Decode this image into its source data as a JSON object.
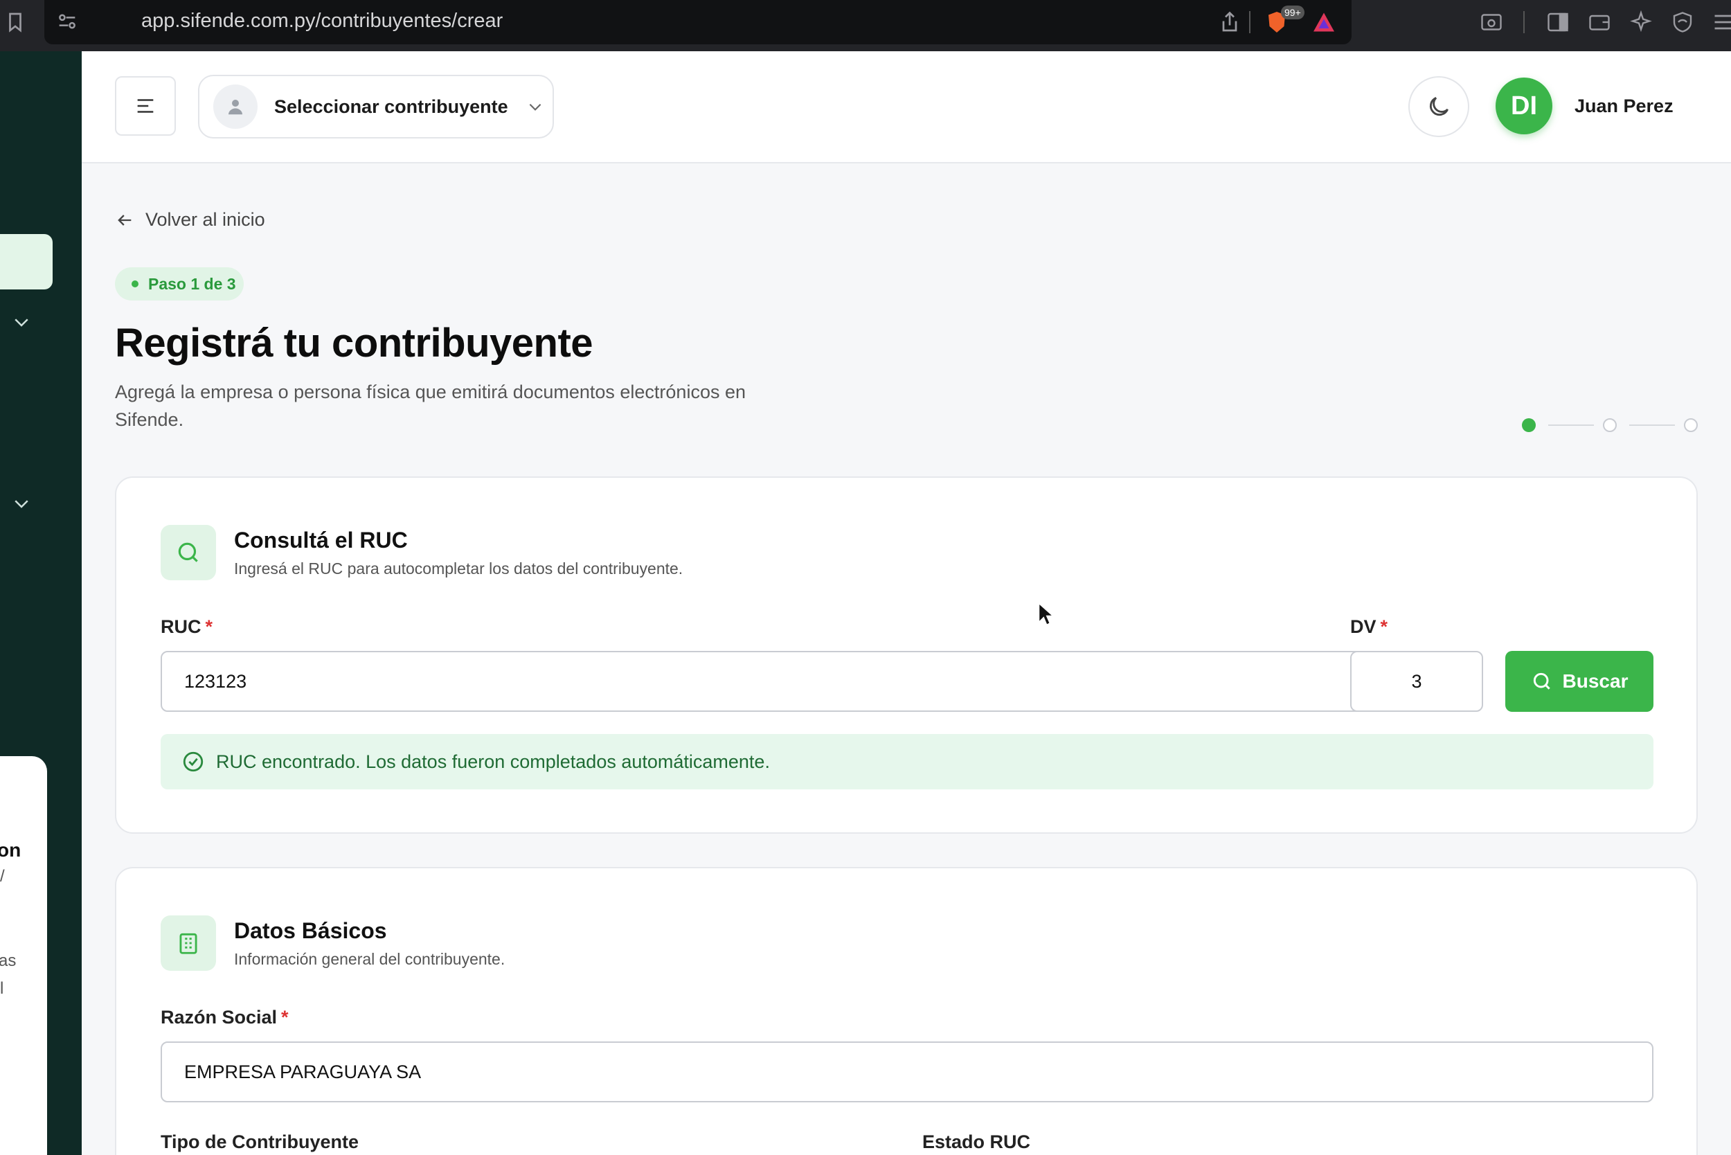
{
  "browser": {
    "url": "app.sifende.com.py/contribuyentes/crear",
    "badge_count": "99+"
  },
  "sidebar": {
    "card_fragments": [
      "on",
      "/",
      "as",
      "l"
    ]
  },
  "header": {
    "contributor_select_label": "Seleccionar contribuyente",
    "user_initials": "DI",
    "user_name": "Juan Perez"
  },
  "main": {
    "back_link": "Volver al inicio",
    "step_badge": "Paso 1 de 3",
    "title": "Registrá tu contribuyente",
    "subtitle": "Agregá la empresa o persona física que emitirá documentos electrónicos en Sifende.",
    "stepper": {
      "current": 1,
      "total": 3
    }
  },
  "ruc_card": {
    "title": "Consultá el RUC",
    "subtitle": "Ingresá el RUC para autocompletar los datos del contribuyente.",
    "ruc_label": "RUC",
    "ruc_value": "123123",
    "dv_label": "DV",
    "dv_value": "3",
    "required_mark": "*",
    "search_button": "Buscar",
    "success_message": "RUC encontrado. Los datos fueron completados automáticamente."
  },
  "basic_card": {
    "title": "Datos Básicos",
    "subtitle": "Información general del contribuyente.",
    "razon_label": "Razón Social",
    "razon_value": "EMPRESA PARAGUAYA SA",
    "required_mark": "*",
    "tipo_label": "Tipo de Contribuyente",
    "estado_label": "Estado RUC"
  },
  "colors": {
    "accent": "#3bb54a",
    "accent_light": "#e1f4e6",
    "sidebar_bg": "#0f2a26",
    "success_bg": "#e6f7ec",
    "required": "#d33333"
  }
}
